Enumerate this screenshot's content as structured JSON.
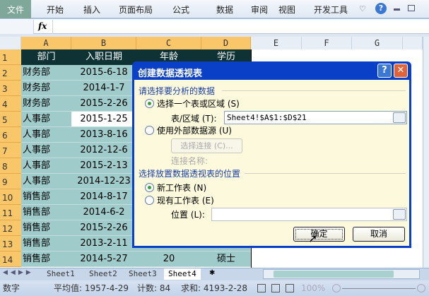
{
  "ribbon": {
    "file": "文件",
    "tabs": [
      "开始",
      "插入",
      "页面布局",
      "公式",
      "数据",
      "审阅",
      "视图",
      "开发工具"
    ]
  },
  "formula_bar": {
    "fx": "fx",
    "value": ""
  },
  "columns": [
    "A",
    "B",
    "C",
    "D",
    "E",
    "F",
    "G"
  ],
  "rows": [
    "1",
    "2",
    "3",
    "4",
    "5",
    "6",
    "7",
    "8",
    "9",
    "10",
    "11",
    "12",
    "13",
    "14"
  ],
  "table": {
    "headers": [
      "部门",
      "入职日期",
      "年龄",
      "学历"
    ],
    "data": [
      [
        "财务部",
        "2015-6-18"
      ],
      [
        "财务部",
        "2014-1-7"
      ],
      [
        "财务部",
        "2015-2-26"
      ],
      [
        "人事部",
        "2015-1-25"
      ],
      [
        "人事部",
        "2013-8-16"
      ],
      [
        "人事部",
        "2012-12-6"
      ],
      [
        "人事部",
        "2015-2-13"
      ],
      [
        "人事部",
        "2014-12-23"
      ],
      [
        "销售部",
        "2014-8-17"
      ],
      [
        "销售部",
        "2014-6-2"
      ],
      [
        "销售部",
        "2015-2-26"
      ],
      [
        "销售部",
        "2013-2-11"
      ],
      [
        "销售部",
        "2014-5-27",
        "20",
        "硕士"
      ]
    ]
  },
  "sheets": [
    "Sheet1",
    "Sheet2",
    "Sheet3",
    "Sheet4"
  ],
  "status": {
    "mode": "数字",
    "average": "平均值: 1957-4-29",
    "count": "计数: 84",
    "sum": "求和: 4193-2-28",
    "zoom": "100%"
  },
  "dialog": {
    "title": "创建数据透视表",
    "help": "?",
    "section1": "请选择要分析的数据",
    "opt_range": "选择一个表或区域 (S)",
    "range_label": "表/区域 (T):",
    "range_value": "Sheet4!$A$1:$D$21",
    "opt_external": "使用外部数据源 (U)",
    "choose_conn": "选择连接 (C)...",
    "conn_name": "连接名称:",
    "section2": "选择放置数据透视表的位置",
    "opt_new": "新工作表 (N)",
    "opt_existing": "现有工作表 (E)",
    "location_label": "位置 (L):",
    "location_value": "",
    "ok": "确定",
    "cancel": "取消"
  }
}
